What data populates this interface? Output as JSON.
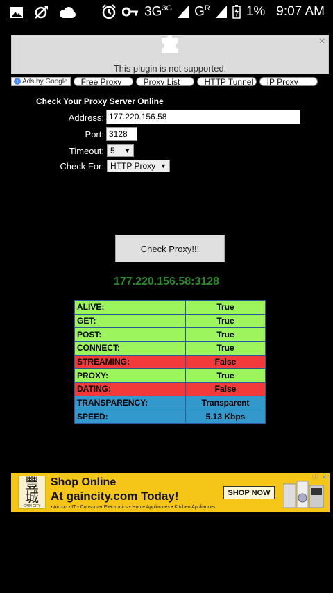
{
  "statusbar": {
    "network": "3G",
    "network_sup": "3G",
    "signal_letter": "G",
    "signal_sup": "R",
    "battery_pct": "1%",
    "time": "9:07 AM"
  },
  "plugin": {
    "message": "This plugin is not supported.",
    "close": "×"
  },
  "adlinks": {
    "ads_by": "Ads by Google",
    "items": [
      "Free Proxy",
      "Proxy List",
      "HTTP Tunnel",
      "IP Proxy"
    ]
  },
  "form": {
    "title": "Check Your Proxy Server Online",
    "address_label": "Address:",
    "address_value": "177.220.156.58",
    "port_label": "Port:",
    "port_value": "3128",
    "timeout_label": "Timeout:",
    "timeout_value": "5",
    "checkfor_label": "Check For:",
    "checkfor_value": "HTTP Proxy",
    "check_button": "Check Proxy!!!"
  },
  "result": {
    "target": "177.220.156.58:3128",
    "rows": [
      {
        "label": "ALIVE:",
        "value": "True",
        "status": "green"
      },
      {
        "label": "GET:",
        "value": "True",
        "status": "green"
      },
      {
        "label": "POST:",
        "value": "True",
        "status": "green"
      },
      {
        "label": "CONNECT:",
        "value": "True",
        "status": "green"
      },
      {
        "label": "STREAMING:",
        "value": "False",
        "status": "red"
      },
      {
        "label": "PROXY:",
        "value": "True",
        "status": "green"
      },
      {
        "label": "DATING:",
        "value": "False",
        "status": "red"
      },
      {
        "label": "TRANSPARENCY:",
        "value": "Transparent",
        "status": "blue"
      },
      {
        "label": "SPEED:",
        "value": "5.13 Kbps",
        "status": "blue"
      }
    ]
  },
  "bottom_ad": {
    "logo_chars": "豐城",
    "logo_small": "GAIN CITY",
    "line1": "Shop Online",
    "line2": "At gaincity.com Today!",
    "line3": "• Aircon • IT • Consumer Electronics • Home Appliances • Kitchen Appliances",
    "cta": "SHOP NOW"
  },
  "colors": {
    "green": "#9cf55c",
    "red": "#f23a3a",
    "blue": "#3399cc",
    "result_title": "#2a8a2a",
    "ad_bg": "#f5c518"
  }
}
